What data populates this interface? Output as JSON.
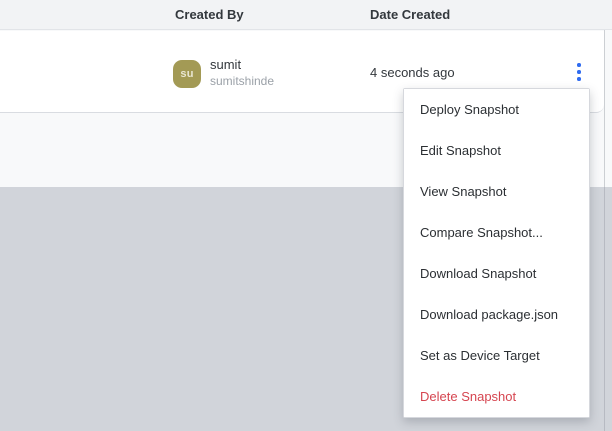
{
  "table": {
    "columns": [
      {
        "label": "Created By"
      },
      {
        "label": "Date Created"
      }
    ],
    "row": {
      "avatar_initials": "su",
      "avatar_color": "#a39a55",
      "name": "sumit",
      "username": "sumitshinde",
      "date_created": "4 seconds ago"
    }
  },
  "kebab_color": "#2f6bf0",
  "menu": {
    "danger_color": "#d64550",
    "items": [
      {
        "label": "Deploy Snapshot",
        "danger": false
      },
      {
        "label": "Edit Snapshot",
        "danger": false
      },
      {
        "label": "View Snapshot",
        "danger": false
      },
      {
        "label": "Compare Snapshot...",
        "danger": false
      },
      {
        "label": "Download Snapshot",
        "danger": false
      },
      {
        "label": "Download package.json",
        "danger": false
      },
      {
        "label": "Set as Device Target",
        "danger": false
      },
      {
        "label": "Delete Snapshot",
        "danger": true
      }
    ]
  }
}
